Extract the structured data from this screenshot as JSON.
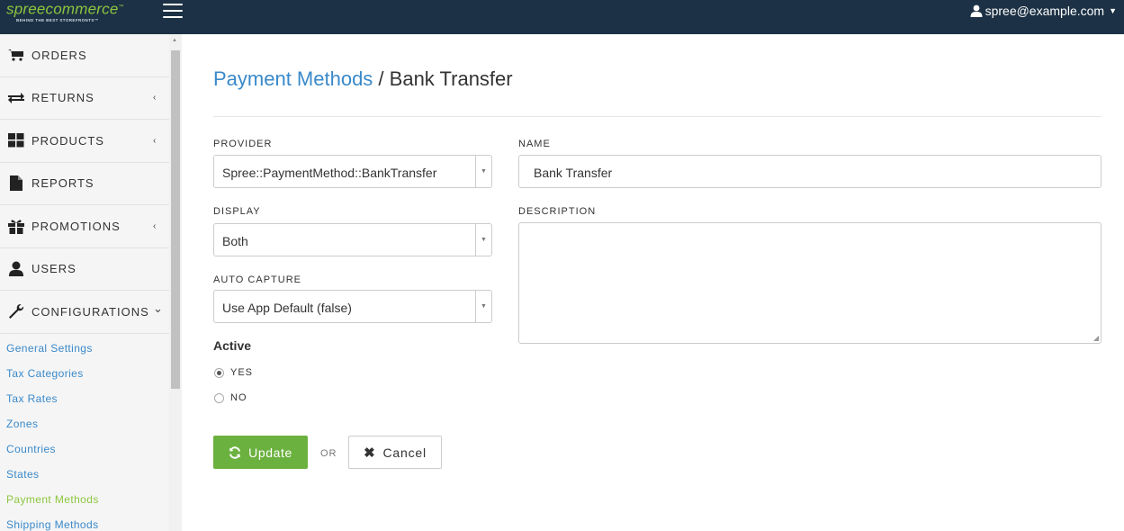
{
  "header": {
    "logo_text": "spreecommerce",
    "logo_trademark": "™",
    "logo_tagline": "BEHIND THE BEST STOREFRONTS™",
    "menu_icon": "hamburger-icon",
    "user_email": "spree@example.com",
    "background": "#1c3145"
  },
  "sidebar": {
    "items": [
      {
        "label": "ORDERS",
        "icon": "cart-icon"
      },
      {
        "label": "RETURNS",
        "icon": "exchange-icon",
        "chevron": "‹"
      },
      {
        "label": "PRODUCTS",
        "icon": "grid-icon",
        "chevron": "‹"
      },
      {
        "label": "REPORTS",
        "icon": "file-icon"
      },
      {
        "label": "PROMOTIONS",
        "icon": "gift-icon",
        "chevron": "‹"
      },
      {
        "label": "USERS",
        "icon": "user-icon"
      },
      {
        "label": "CONFIGURATIONS",
        "icon": "wrench-icon",
        "chevron": "⌄"
      }
    ],
    "sub_items": [
      {
        "label": "General Settings"
      },
      {
        "label": "Tax Categories"
      },
      {
        "label": "Tax Rates"
      },
      {
        "label": "Zones"
      },
      {
        "label": "Countries"
      },
      {
        "label": "States"
      },
      {
        "label": "Payment Methods",
        "active": true
      },
      {
        "label": "Shipping Methods"
      }
    ]
  },
  "page": {
    "breadcrumb_link": "Payment Methods",
    "separator": " / ",
    "title": "Bank Transfer"
  },
  "form": {
    "provider_label": "PROVIDER",
    "provider_value": "Spree::PaymentMethod::BankTransfer",
    "display_label": "DISPLAY",
    "display_value": "Both",
    "auto_capture_label": "AUTO CAPTURE",
    "auto_capture_value": "Use App Default (false)",
    "name_label": "NAME",
    "name_value": "Bank Transfer",
    "description_label": "DESCRIPTION",
    "description_value": "",
    "active_label": "Active",
    "active_yes": "YES",
    "active_no": "NO",
    "active_selected": "YES",
    "update_label": "Update",
    "or_label": "OR",
    "cancel_label": "Cancel"
  },
  "colors": {
    "accent_link": "#3a89c9",
    "accent_green": "#6bb13f",
    "active_sub": "#8dc63f"
  }
}
